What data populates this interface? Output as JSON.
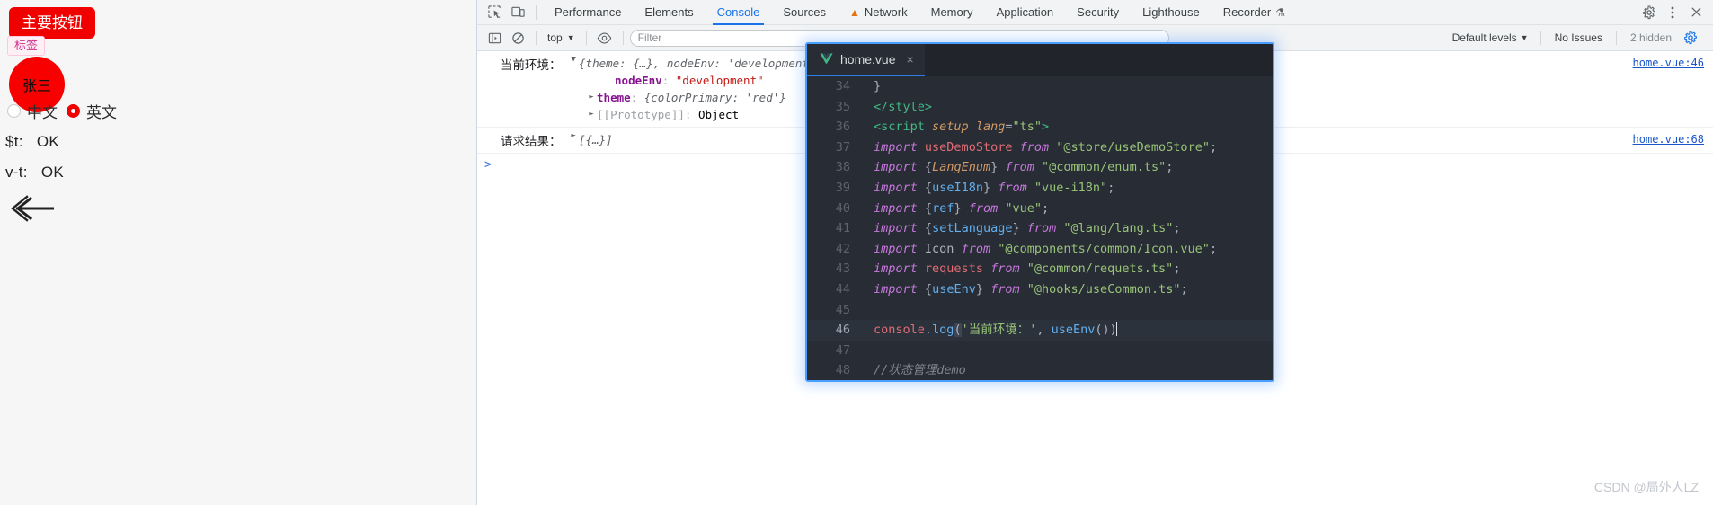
{
  "app_page": {
    "primary_button": "主要按钮",
    "tag": "标签",
    "avatar_name": "张三",
    "radios": [
      {
        "label": "中文",
        "checked": false
      },
      {
        "label": "英文",
        "checked": true
      }
    ],
    "lines": [
      {
        "key": "$t:",
        "value": "OK"
      },
      {
        "key": "v-t:",
        "value": "OK"
      }
    ],
    "arrow_icon": "left-arrow-icon",
    "colors": {
      "primary": "#f10000",
      "tag_bg": "#fff0f5",
      "tag_text": "#d1318c"
    }
  },
  "devtools": {
    "toolbar_icons": [
      {
        "name": "inspect-element-icon"
      },
      {
        "name": "device-toolbar-icon"
      }
    ],
    "tabs": [
      {
        "label": "Performance",
        "active": false,
        "warn": false
      },
      {
        "label": "Elements",
        "active": false,
        "warn": false
      },
      {
        "label": "Console",
        "active": true,
        "warn": false
      },
      {
        "label": "Sources",
        "active": false,
        "warn": false
      },
      {
        "label": "Network",
        "active": false,
        "warn": true
      },
      {
        "label": "Memory",
        "active": false,
        "warn": false
      },
      {
        "label": "Application",
        "active": false,
        "warn": false
      },
      {
        "label": "Security",
        "active": false,
        "warn": false
      },
      {
        "label": "Lighthouse",
        "active": false,
        "warn": false
      },
      {
        "label": "Recorder",
        "active": false,
        "warn": false,
        "flask": true
      }
    ],
    "right_icons": [
      {
        "name": "settings-gear-icon"
      },
      {
        "name": "more-options-icon"
      },
      {
        "name": "close-devtools-icon"
      }
    ],
    "filter_bar": {
      "sidebar_toggle": "console-sidebar-icon",
      "clear": "clear-console-icon",
      "context": "top",
      "eye": "live-expression-icon",
      "filter_placeholder": "Filter",
      "filter_value": "",
      "levels": "Default levels",
      "issues": "No Issues",
      "hidden": "2 hidden",
      "settings": "console-settings-icon"
    },
    "console": {
      "entries": [
        {
          "label": "当前环境：",
          "summary": "{theme: {…}, nodeEnv: 'development'}",
          "expanded": true,
          "props": [
            {
              "name": "nodeEnv",
              "value": "\"development\"",
              "kind": "string",
              "expandable": false
            },
            {
              "name": "theme",
              "value": "{colorPrimary: 'red'}",
              "kind": "object",
              "expandable": true
            },
            {
              "name": "[[Prototype]]",
              "value": "Object",
              "kind": "proto",
              "expandable": true
            }
          ],
          "source": "home.vue:46"
        },
        {
          "label": "请求结果：",
          "summary": "[{…}]",
          "expanded": false,
          "props": [],
          "source": "home.vue:68"
        }
      ],
      "prompt": ">"
    }
  },
  "editor": {
    "tab": {
      "filename": "home.vue",
      "icon": "vue-logo-icon",
      "close": "×"
    },
    "lines": [
      {
        "num": "34",
        "text": "}"
      },
      {
        "num": "35",
        "text": "</style>"
      },
      {
        "num": "36",
        "text": "<script setup lang=\"ts\">"
      },
      {
        "num": "37",
        "text": "import useDemoStore from \"@store/useDemoStore\";"
      },
      {
        "num": "38",
        "text": "import {LangEnum} from \"@common/enum.ts\";"
      },
      {
        "num": "39",
        "text": "import {useI18n} from \"vue-i18n\";"
      },
      {
        "num": "40",
        "text": "import {ref} from \"vue\";"
      },
      {
        "num": "41",
        "text": "import {setLanguage} from \"@lang/lang.ts\";"
      },
      {
        "num": "42",
        "text": "import Icon from \"@components/common/Icon.vue\";"
      },
      {
        "num": "43",
        "text": "import requests from \"@common/requets.ts\";"
      },
      {
        "num": "44",
        "text": "import {useEnv} from \"@hooks/useCommon.ts\";"
      },
      {
        "num": "45",
        "text": ""
      },
      {
        "num": "46",
        "text": "console.log('当前环境：', useEnv())",
        "current": true
      },
      {
        "num": "47",
        "text": ""
      },
      {
        "num": "48",
        "text": "//状态管理demo"
      }
    ]
  },
  "watermark": "CSDN @局外人LZ"
}
